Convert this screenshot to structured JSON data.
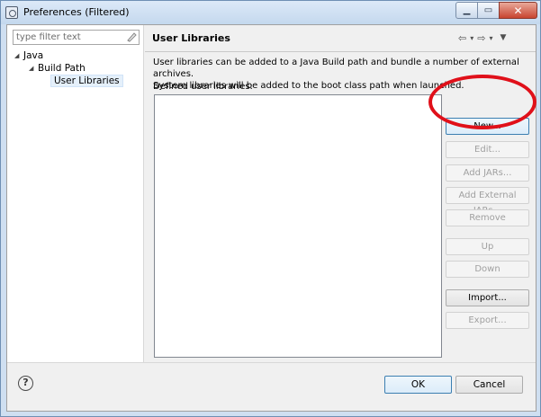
{
  "window": {
    "title": "Preferences (Filtered)",
    "minimize_label": "▁",
    "maximize_label": "▭",
    "close_label": "✕"
  },
  "filter": {
    "placeholder": "type filter text",
    "clear_icon": "clear-filter-icon"
  },
  "tree": [
    {
      "label": "Java",
      "expanded": true,
      "level": 0
    },
    {
      "label": "Build Path",
      "expanded": true,
      "level": 1
    },
    {
      "label": "User Libraries",
      "expanded": false,
      "level": 2,
      "selected": true
    }
  ],
  "page": {
    "title": "User Libraries",
    "description_line1": "User libraries can be added to a Java Build path and bundle a number of external archives.",
    "description_line2": "System libraries will be added to the boot class path when launched.",
    "list_label": "Defined user libraries:",
    "libraries": []
  },
  "nav": {
    "back": "⇦",
    "back_menu": "▾",
    "forward": "⇨",
    "forward_menu": "▾",
    "view_menu": "▼"
  },
  "buttons": [
    {
      "label": "New...",
      "enabled": true
    },
    {
      "label": "Edit...",
      "enabled": false
    },
    {
      "label": "Add JARs...",
      "enabled": false
    },
    {
      "label": "Add External JARs...",
      "enabled": false
    },
    {
      "label": "Remove",
      "enabled": false
    },
    {
      "label": "Up",
      "enabled": false
    },
    {
      "label": "Down",
      "enabled": false
    },
    {
      "label": "Import...",
      "enabled": true
    },
    {
      "label": "Export...",
      "enabled": false
    }
  ],
  "footer": {
    "help": "?",
    "ok": "OK",
    "cancel": "Cancel"
  },
  "colors": {
    "annotation": "#e0101a",
    "titlebar": "#c4d8ee",
    "close_button": "#c8442f"
  }
}
